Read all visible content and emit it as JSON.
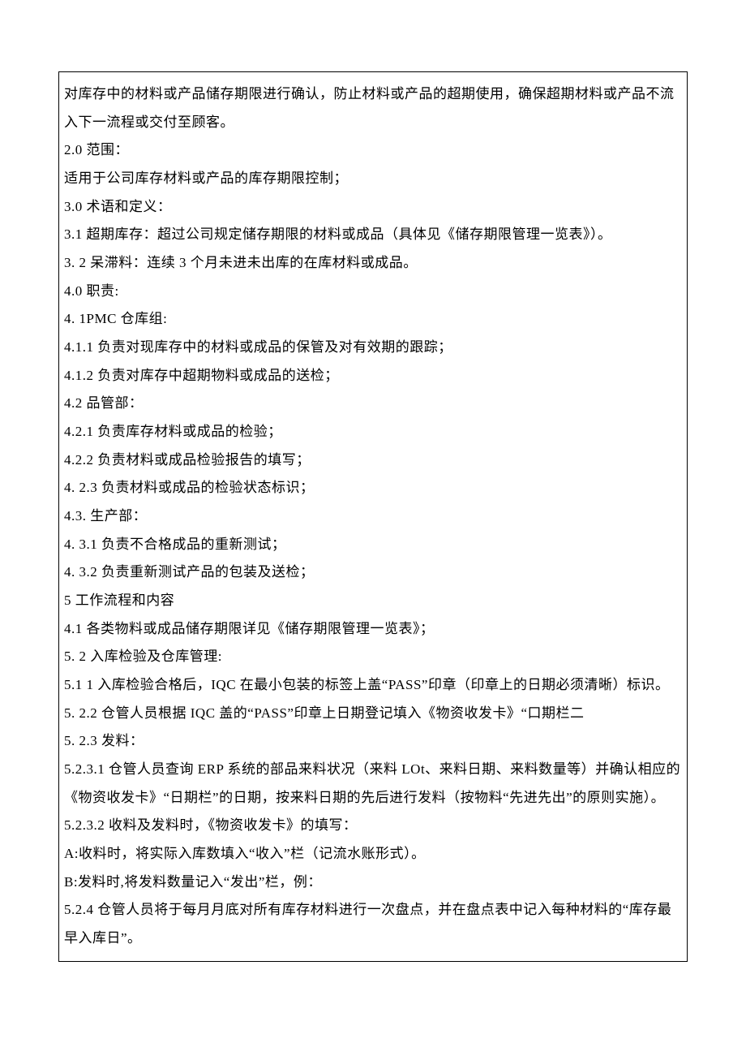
{
  "lines": [
    "对库存中的材料或产品储存期限进行确认，防止材料或产品的超期使用，确保超期材料或产品不流入下一流程或交付至顾客。",
    "2.0 范围：",
    "适用于公司库存材料或产品的库存期限控制；",
    "3.0 术语和定义：",
    "3.1 超期库存：超过公司规定储存期限的材料或成品（具体见《储存期限管理一览表》）。",
    "3.  2 呆滞料：连续 3 个月未进未出库的在库材料或成品。",
    "4.0 职责:",
    "4.  1PMC 仓库组:",
    "4.1.1 负责对现库存中的材料或成品的保管及对有效期的跟踪；",
    "4.1.2 负责对库存中超期物料或成品的送检；",
    "4.2 品管部：",
    "4.2.1 负责库存材料或成品的检验；",
    "4.2.2 负责材料或成品检验报告的填写；",
    "4.  2.3 负责材料或成品的检验状态标识；",
    "4.3.  生产部：",
    "4.  3.1 负责不合格成品的重新测试；",
    "4.  3.2 负责重新测试产品的包装及送检；",
    "5 工作流程和内容",
    "4.1   各类物料或成品储存期限详见《储存期限管理一览表》；",
    "5.  2 入库检验及仓库管理:",
    "5.1   1 入库检验合格后，IQC 在最小包装的标签上盖“PASS”印章（印章上的日期必须清晰）标识。",
    "5.  2.2 仓管人员根据 IQC 盖的“PASS”印章上日期登记填入《物资收发卡》“口期栏二",
    "5.  2.3 发料：",
    "5.2.3.1 仓管人员查询 ERP 系统的部品来料状况（来料 LOt、来料日期、来料数量等）并确认相应的《物资收发卡》“日期栏”的日期，按来料日期的先后进行发料（按物料“先进先出”的原则实施）。",
    "5.2.3.2 收料及发料时，《物资收发卡》的填写：",
    "A:收料时，将实际入库数填入“收入”栏（记流水账形式）。",
    "B:发料时,将发料数量记入“发出”栏，例：",
    "5.2.4 仓管人员将于每月月底对所有库存材料进行一次盘点，并在盘点表中记入每种材料的“库存最早入库日”。"
  ]
}
